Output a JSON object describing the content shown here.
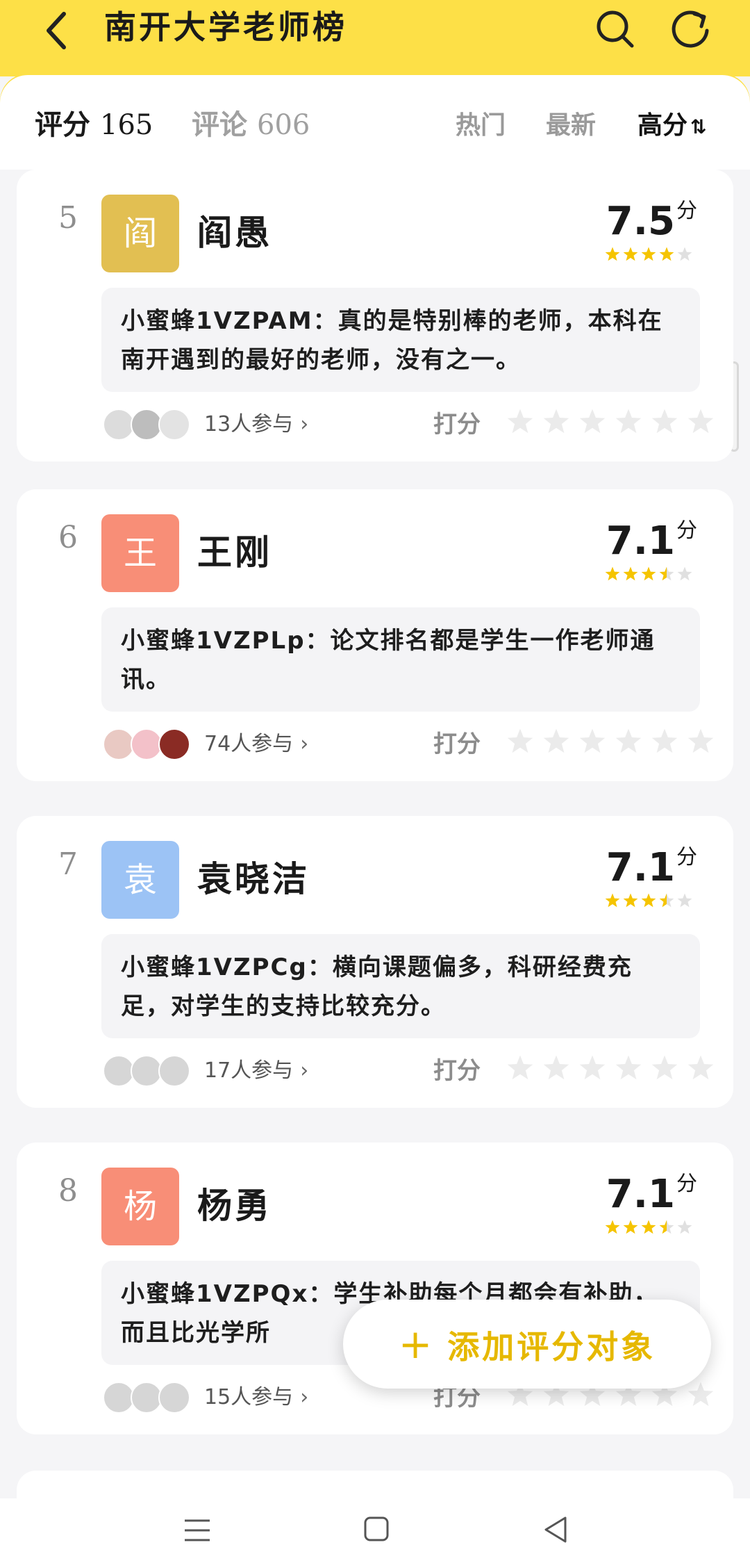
{
  "header": {
    "title": "南开大学老师榜",
    "back_icon": "back-arrow-icon",
    "search_icon": "search-icon",
    "refresh_icon": "refresh-icon",
    "bg_color": "#fde047"
  },
  "tabs": {
    "rating_label": "评分",
    "rating_count": "165",
    "comment_label": "评论",
    "comment_count": "606"
  },
  "sort": {
    "hot": "热门",
    "latest": "最新",
    "high": "高分",
    "sort_icon": "⇅"
  },
  "teachers": [
    {
      "rank": "5",
      "avatar_char": "阎",
      "avatar_color": "#e2bf52",
      "name": "阎愚",
      "score": "7.5",
      "score_unit": "分",
      "stars": 4,
      "comment": "小蜜蜂1VZPAM：真的是特别棒的老师，本科在南开遇到的最好的老师，没有之一。",
      "participants": "13人参与",
      "rate_label": "打分"
    },
    {
      "rank": "6",
      "avatar_char": "王",
      "avatar_color": "#f88e77",
      "name": "王刚",
      "score": "7.1",
      "score_unit": "分",
      "stars": 3.5,
      "comment": "小蜜蜂1VZPLp：论文排名都是学生一作老师通讯。",
      "participants": "74人参与",
      "rate_label": "打分"
    },
    {
      "rank": "7",
      "avatar_char": "袁",
      "avatar_color": "#9cc3f5",
      "name": "袁晓洁",
      "score": "7.1",
      "score_unit": "分",
      "stars": 3.5,
      "comment": "小蜜蜂1VZPCg：横向课题偏多，科研经费充足，对学生的支持比较充分。",
      "participants": "17人参与",
      "rate_label": "打分"
    },
    {
      "rank": "8",
      "avatar_char": "杨",
      "avatar_color": "#f88e77",
      "name": "杨勇",
      "score": "7.1",
      "score_unit": "分",
      "stars": 3.5,
      "comment": "小蜜蜂1VZPQx：学生补助每个月都会有补助，而且比光学所",
      "participants": "15人参与",
      "rate_label": "打分"
    }
  ],
  "fab": {
    "label": "添加评分对象",
    "plus": "+",
    "color": "#e6b800"
  },
  "navbar": {
    "menu_icon": "menu-icon",
    "home_icon": "home-icon",
    "back_icon": "nav-back-icon"
  }
}
